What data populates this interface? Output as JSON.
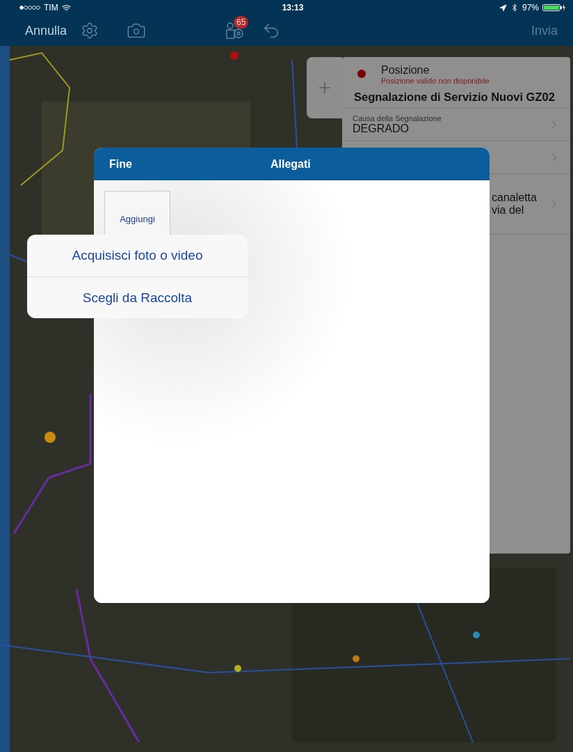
{
  "status_bar": {
    "carrier": "TIM",
    "time": "13:13",
    "battery": "97%"
  },
  "nav_bar": {
    "cancel": "Annulla",
    "badge": "65",
    "send": {
      "label": "Invia",
      "disabled": true
    }
  },
  "form_panel": {
    "position_title": "Posizione",
    "position_status": "Posizione valido non disponibile",
    "title": "Segnalazione di Servizio Nuovi GZ02",
    "rows": [
      {
        "label": "Causa della Segnalazione",
        "value": "DEGRADO"
      },
      {},
      {
        "lines": [
          "canaletta",
          "via del"
        ]
      }
    ]
  },
  "attachments_modal": {
    "done": "Fine",
    "title": "Allegati",
    "add_tile": "Aggiungi"
  },
  "popover": {
    "actions": [
      "Acquisisci foto o video",
      "Scegli da Raccolta"
    ]
  }
}
